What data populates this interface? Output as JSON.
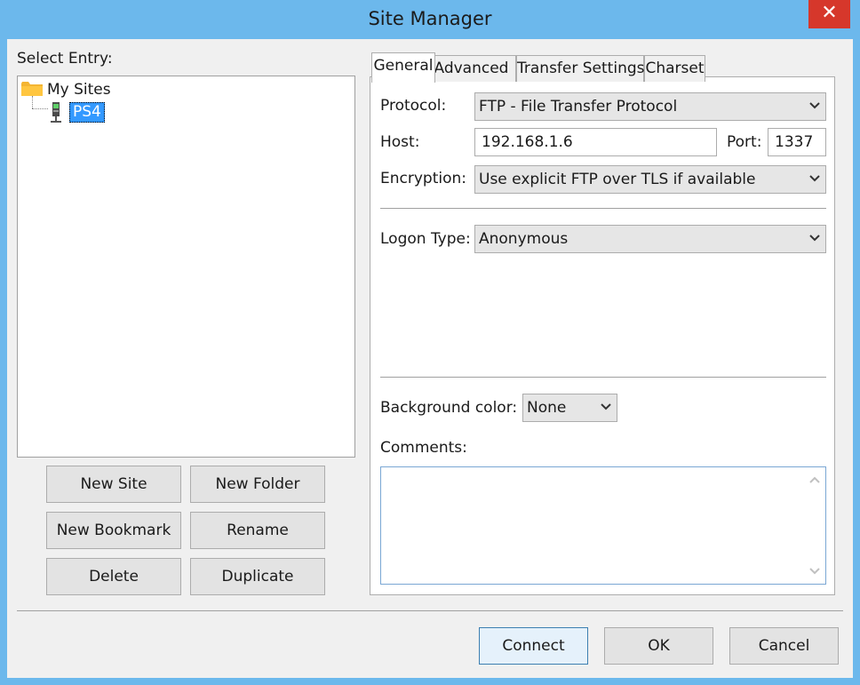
{
  "window": {
    "title": "Site Manager",
    "close_label": "✕"
  },
  "tree": {
    "select_label": "Select Entry:",
    "root_label": "My Sites",
    "items": [
      {
        "label": "PS4",
        "selected": true
      }
    ]
  },
  "left_buttons": {
    "new_site": "New Site",
    "new_folder": "New Folder",
    "new_bookmark": "New Bookmark",
    "rename": "Rename",
    "delete": "Delete",
    "duplicate": "Duplicate"
  },
  "tabs": [
    {
      "label": "General",
      "active": true
    },
    {
      "label": "Advanced",
      "active": false
    },
    {
      "label": "Transfer Settings",
      "active": false
    },
    {
      "label": "Charset",
      "active": false
    }
  ],
  "general": {
    "protocol_label": "Protocol:",
    "protocol_value": "FTP - File Transfer Protocol",
    "host_label": "Host:",
    "host_value": "192.168.1.6",
    "port_label": "Port:",
    "port_value": "1337",
    "encryption_label": "Encryption:",
    "encryption_value": "Use explicit FTP over TLS if available",
    "logon_type_label": "Logon Type:",
    "logon_type_value": "Anonymous",
    "bg_color_label": "Background color:",
    "bg_color_value": "None",
    "comments_label": "Comments:",
    "comments_value": ""
  },
  "bottom_buttons": {
    "connect": "Connect",
    "ok": "OK",
    "cancel": "Cancel"
  },
  "colors": {
    "accent": "#6cb8ec",
    "selection": "#3399ff",
    "close": "#d6372b"
  }
}
